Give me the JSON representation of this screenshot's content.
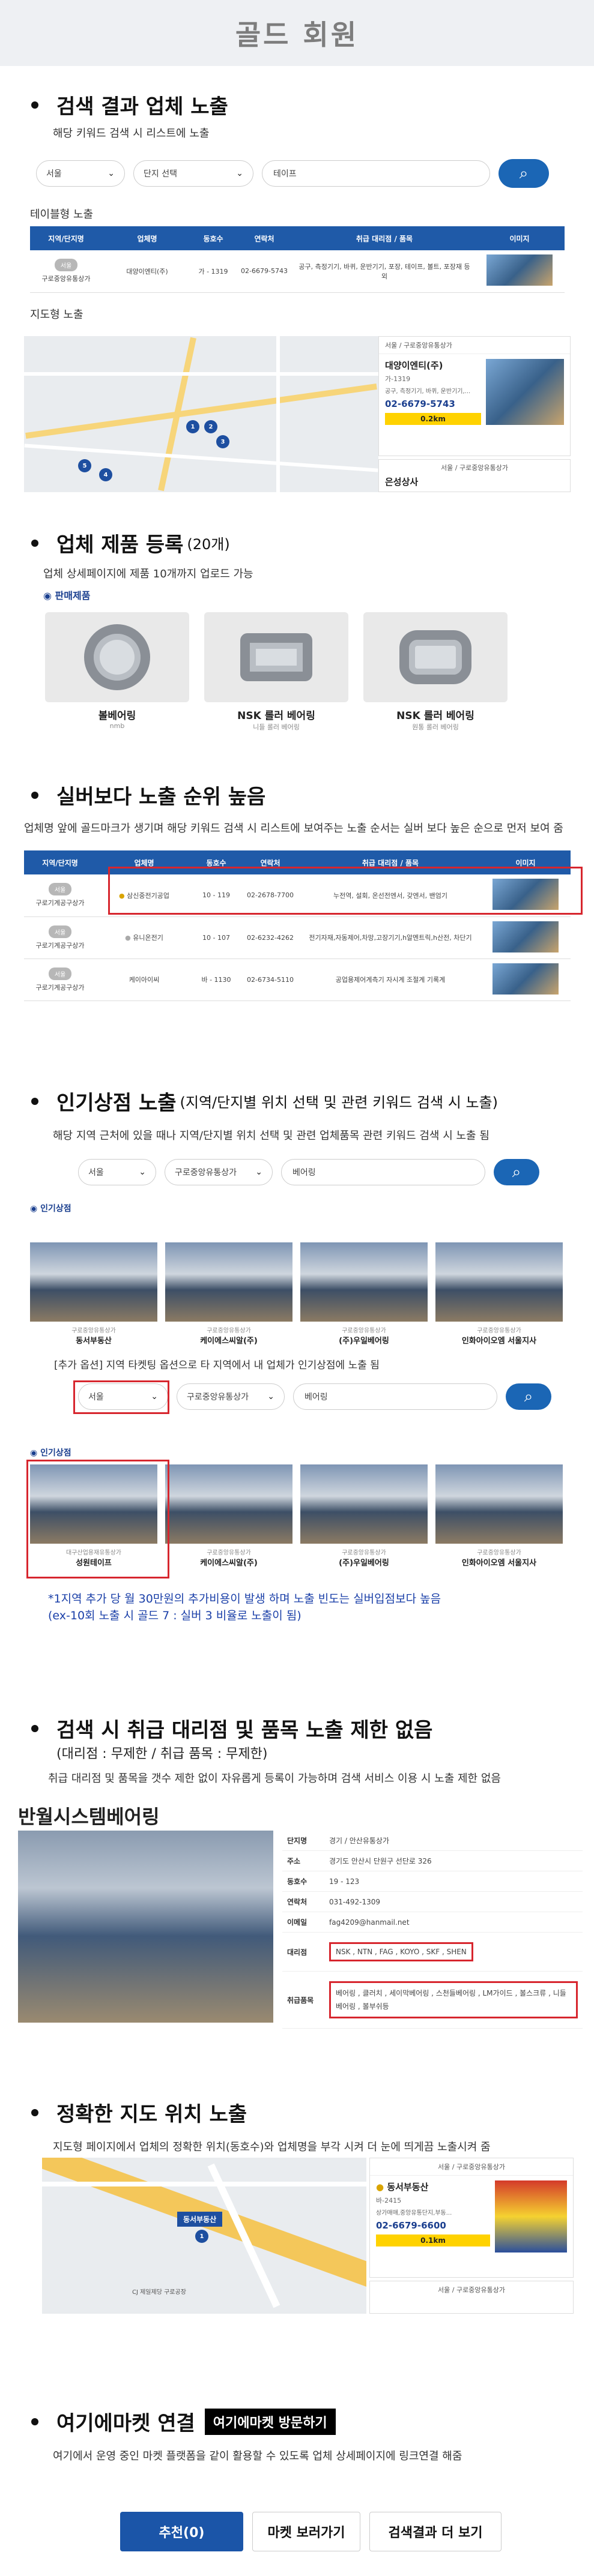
{
  "page_title": "골드 회원",
  "s1": {
    "heading": "검색 결과 업체 노출",
    "desc": "해당 키워드 검색 시 리스트에 노출",
    "search": {
      "region": "서울",
      "complex": "단지 선택",
      "keyword": "테이프"
    },
    "table_label": "테이블형 노출",
    "columns": [
      "지역/단지명",
      "업체명",
      "동호수",
      "연락처",
      "취급 대리점 / 품목",
      "이미지"
    ],
    "row": {
      "badge": "서울",
      "area": "구로중앙유통상가",
      "name": "대양이엔티(주)",
      "room": "가 - 1319",
      "phone": "02-6679-5743",
      "items": "공구, 측정기기, 바퀴, 운반기기, 포장, 테이프, 볼트, 포장재 등 외"
    },
    "map_label": "지도형 노출",
    "card": {
      "area": "서울 / 구로중앙유통상가",
      "name": "대양이엔티(주)",
      "room": "가-1319",
      "items": "공구, 측정기기, 바퀴, 운반기기,...",
      "phone": "02-6679-5743",
      "dist": "0.2km"
    },
    "card2": {
      "area": "서울 / 구로중앙유통상가",
      "name": "은성상사"
    }
  },
  "s2": {
    "heading": "업체 제품 등록",
    "count": "(20개)",
    "desc": "업체 상세페이지에 제품 10개까지 업로드 가능",
    "sub": "판매제품",
    "products": [
      {
        "name": "볼베어링",
        "sub": "nmb"
      },
      {
        "name": "NSK 롤러 베어링",
        "sub": "니들 롤러 베어링"
      },
      {
        "name": "NSK 롤러 베어링",
        "sub": "원통 롤러 베어링"
      }
    ]
  },
  "s3": {
    "heading": "실버보다 노출 순위 높음",
    "desc": "업체명 앞에 골드마크가 생기며 해당 키워드 검색 시 리스트에 보여주는 노출 순서는 실버 보다 높은 순으로 먼저 보여 줌",
    "columns": [
      "지역/단지명",
      "업체명",
      "동호수",
      "연락처",
      "취급 대리점 / 품목",
      "이미지"
    ],
    "rows": [
      {
        "badge": "서울",
        "area": "구로기계공구상가",
        "name": "삼신중전기공업",
        "room": "10 - 119",
        "phone": "02-2678-7700",
        "items": "누전역, 설회, 온선전엔서, 갖엔서, 밴엄기"
      },
      {
        "badge": "서울",
        "area": "구로기계공구상가",
        "name": "유니온전기",
        "room": "10 - 107",
        "phone": "02-6232-4262",
        "items": "전기자재,자동제어,차망,고장기기,h알멘트릭,h산전, 차단기"
      },
      {
        "badge": "서울",
        "area": "구로기계공구상가",
        "name": "케이아이씨",
        "room": "바 - 1130",
        "phone": "02-6734-5110",
        "items": "공업용제어계측기 자시계 조절계 기록계"
      }
    ]
  },
  "s4": {
    "heading": "인기상점 노출",
    "heading_sub": "(지역/단지별 위치 선택 및 관련 키워드 검색 시 노출)",
    "desc": "해당 지역 근처에 있을 때나 지역/단지별 위치 선택 및 관련 업체품목 관련 키워드 검색 시 노출 됨",
    "search": {
      "region": "서울",
      "complex": "구로중앙유통상가",
      "keyword": "베어링"
    },
    "sub": "인기상점",
    "shops": [
      {
        "area": "구로중앙유통상가",
        "name": "동서부동산"
      },
      {
        "area": "구로중앙유통상가",
        "name": "케이에스씨알(주)"
      },
      {
        "area": "구로중앙유통상가",
        "name": "(주)우일베어링"
      },
      {
        "area": "구로중앙유통상가",
        "name": "인화아이오엠 서울지사"
      }
    ],
    "option_desc": "[추가 옵션] 지역 타켓팅 옵션으로 타 지역에서 내 업체가 인기상점에 노출 됨",
    "search2": {
      "region": "서울",
      "complex": "구로중앙유통상가",
      "keyword": "베어링"
    },
    "sub2": "인기상점",
    "shops2": [
      {
        "area": "대구산업용재유통상가",
        "name": "성원테이프"
      },
      {
        "area": "구로중앙유통상가",
        "name": "케이에스씨알(주)"
      },
      {
        "area": "구로중앙유통상가",
        "name": "(주)우일베어링"
      },
      {
        "area": "구로중앙유통상가",
        "name": "인화아이오엠 서울지사"
      }
    ],
    "note1": "*1지역 추가 당 월 30만원의 추가비용이 발생 하며 노출 빈도는 실버입점보다 높음",
    "note2": "(ex-10회 노출 시 골드 7 : 실버 3 비율로 노출이 됨)"
  },
  "s5": {
    "heading": "검색 시 취급 대리점 및 품목 노출 제한 없음",
    "heading_sub": "(대리점 : 무제한 / 취급 품목 : 무제한)",
    "desc": "취급 대리점 및 품목을 갯수 제한 없이 자유롭게 등록이 가능하며 검색 서비스 이용 시 노출 제한 없음",
    "company": "반월시스템베어링",
    "info": [
      {
        "k": "단지명",
        "v": "경기 / 안산유통상가"
      },
      {
        "k": "주소",
        "v": "경기도 안산시 단원구 선단로 326"
      },
      {
        "k": "동호수",
        "v": "19 - 123"
      },
      {
        "k": "연락처",
        "v": "031-492-1309"
      },
      {
        "k": "이메일",
        "v": "fag4209@hanmail.net"
      },
      {
        "k": "대리점",
        "v": "NSK , NTN , FAG , KOYO , SKF , SHEN"
      },
      {
        "k": "취급품목",
        "v": "베어링 , 클러치 , 세이막베어링 , 스천들베어링 , LM가이드 , 볼스크류 , 니들베어링 , 볼부쉬등"
      }
    ]
  },
  "s6": {
    "heading": "정확한 지도 위치 노출",
    "desc": "지도형 페이지에서 업체의 정확한 위치(동호수)와 업체명을 부각 시켜 더 눈에 띄게끔 노출시켜 줌",
    "card": {
      "area": "서울 / 구로중앙유통상가",
      "name": "동서부동산",
      "room": "바-2415",
      "items": "상가매매,중앙유통단지,부동...",
      "phone": "02-6679-6600",
      "dist": "0.1km"
    },
    "card2": {
      "area": "서울 / 구로중앙유통상가"
    },
    "marker": "동서부동산",
    "bldg": "CJ 제일제당 구로공장"
  },
  "s7": {
    "heading": "여기에마켓 연결",
    "tag": "여기에마켓 방문하기",
    "desc": "여기에서 운영 중인 마켓 플랫폼을 같이 활용할 수 있도록 업체 상세페이지에 링크연결 해줌"
  },
  "buttons": {
    "recommend": "추천(0)",
    "market": "마켓 보러가기",
    "more": "검색결과 더 보기"
  }
}
